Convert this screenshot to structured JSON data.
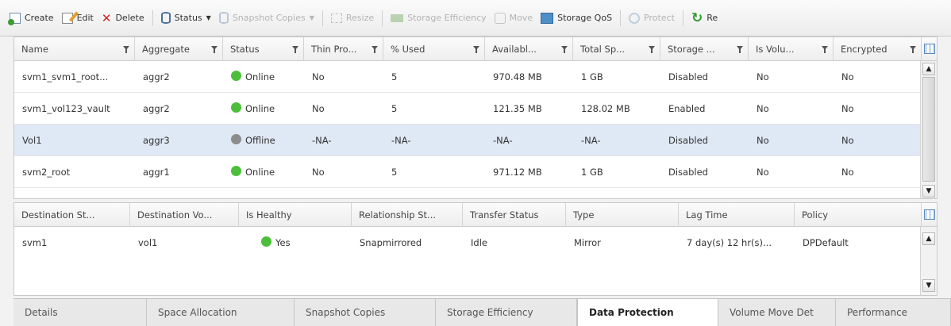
{
  "toolbar": {
    "items": [
      {
        "label": "Create",
        "icon": "create-icon",
        "enabled": true
      },
      {
        "label": "Edit",
        "icon": "edit-icon",
        "enabled": true
      },
      {
        "label": "Delete",
        "icon": "delete-icon",
        "enabled": true
      },
      {
        "label": "Status",
        "icon": "status-icon",
        "enabled": true
      },
      {
        "label": "Snapshot Copies",
        "icon": "snapshot-icon",
        "enabled": false
      },
      {
        "label": "Resize",
        "icon": "resize-icon",
        "enabled": false
      },
      {
        "label": "Storage Efficiency",
        "icon": "efficiency-icon",
        "enabled": false
      },
      {
        "label": "Move",
        "icon": "move-icon",
        "enabled": false
      },
      {
        "label": "Storage QoS",
        "icon": "qos-icon",
        "enabled": true
      },
      {
        "label": "Protect",
        "icon": "protect-icon",
        "enabled": false
      },
      {
        "label": "Re",
        "icon": "refresh-icon",
        "enabled": true
      }
    ]
  },
  "volumes": {
    "columns": [
      "Name",
      "Aggregate",
      "Status",
      "Thin Pro...",
      "% Used",
      "Availabl...",
      "Total Sp...",
      "Storage ...",
      "Is Volu...",
      "Encrypted"
    ],
    "rows": [
      {
        "name": "svm1_svm1_root...",
        "aggregate": "aggr2",
        "status": "Online",
        "thin": "No",
        "used": "5",
        "available": "970.48 MB",
        "total": "1 GB",
        "storage": "Disabled",
        "is_volume": "No",
        "encrypted": "No",
        "selected": false
      },
      {
        "name": "svm1_vol123_vault",
        "aggregate": "aggr2",
        "status": "Online",
        "thin": "No",
        "used": "5",
        "available": "121.35 MB",
        "total": "128.02 MB",
        "storage": "Enabled",
        "is_volume": "No",
        "encrypted": "No",
        "selected": false
      },
      {
        "name": "Vol1",
        "aggregate": "aggr3",
        "status": "Offline",
        "thin": "-NA-",
        "used": "-NA-",
        "available": "-NA-",
        "total": "-NA-",
        "storage": "Disabled",
        "is_volume": "No",
        "encrypted": "No",
        "selected": true
      },
      {
        "name": "svm2_root",
        "aggregate": "aggr1",
        "status": "Online",
        "thin": "No",
        "used": "5",
        "available": "971.12 MB",
        "total": "1 GB",
        "storage": "Disabled",
        "is_volume": "No",
        "encrypted": "No",
        "selected": false
      }
    ]
  },
  "protection": {
    "columns": [
      "Destination St...",
      "Destination Vo...",
      "Is Healthy",
      "Relationship St...",
      "Transfer Status",
      "Type",
      "Lag Time",
      "Policy"
    ],
    "rows": [
      {
        "dest_svm": "svm1",
        "dest_volume": "vol1",
        "healthy": "Yes",
        "relationship": "Snapmirrored",
        "transfer": "Idle",
        "type": "Mirror",
        "lag": "7 day(s) 12 hr(s)...",
        "policy": "DPDefault"
      }
    ]
  },
  "tabs": [
    {
      "label": "Details",
      "active": false
    },
    {
      "label": "Space Allocation",
      "active": false
    },
    {
      "label": "Snapshot Copies",
      "active": false
    },
    {
      "label": "Storage Efficiency",
      "active": false
    },
    {
      "label": "Data Protection",
      "active": true
    },
    {
      "label": "Volume Move Det",
      "active": false
    },
    {
      "label": "Performance",
      "active": false
    }
  ],
  "colors": {
    "online": "#4cbf3a",
    "offline": "#8c8c8c",
    "healthy": "#4cbf3a",
    "selected_row": "#dfe8f5",
    "delete_icon": "#d32222"
  }
}
